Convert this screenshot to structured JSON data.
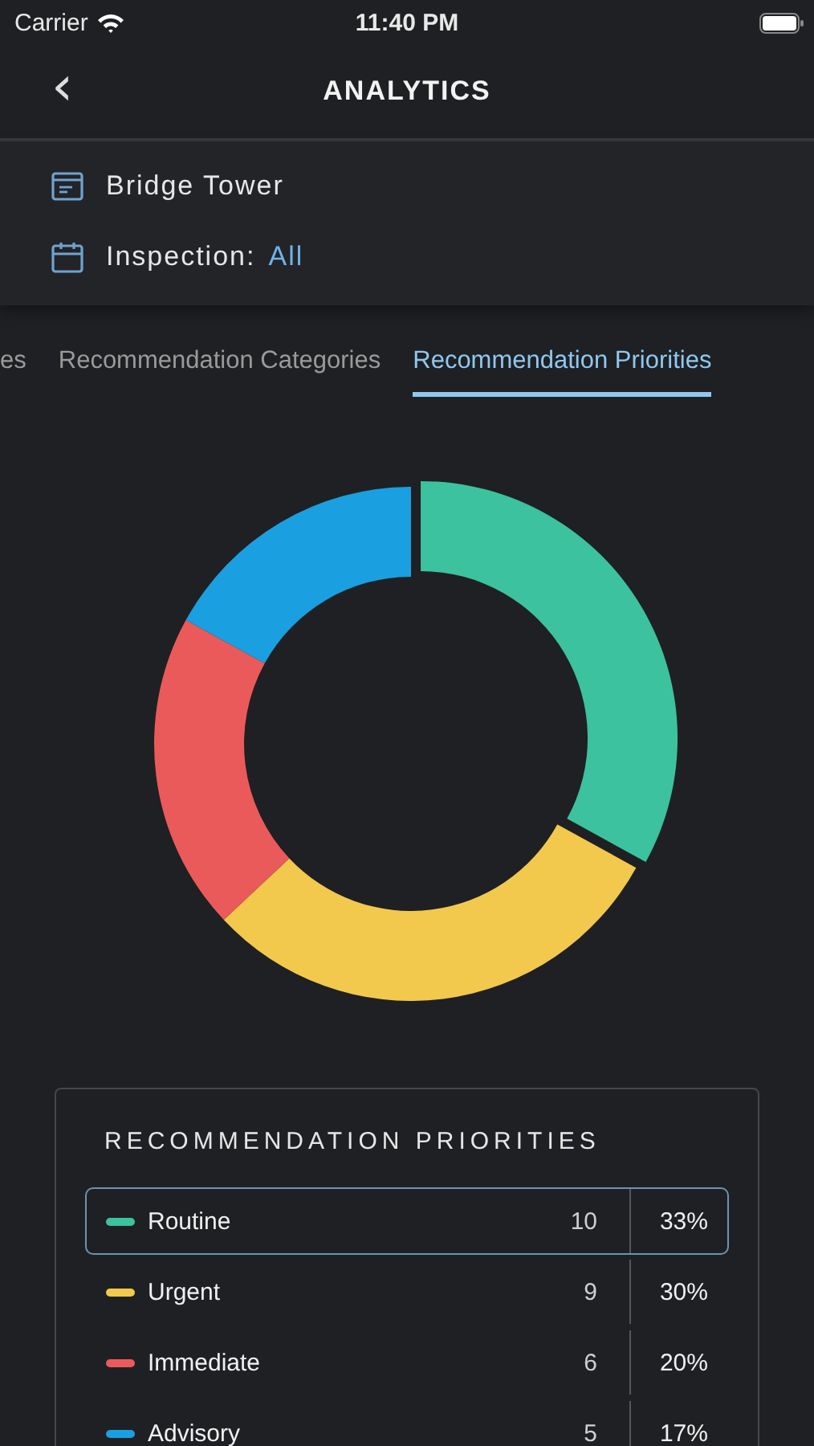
{
  "status_bar": {
    "carrier": "Carrier",
    "time": "11:40 PM"
  },
  "nav": {
    "back": "‹",
    "title": "ANALYTICS"
  },
  "info": {
    "site": "Bridge Tower",
    "inspection_label": "Inspection:",
    "inspection_value": "All"
  },
  "tabs": [
    {
      "label": "es",
      "selected": false
    },
    {
      "label": "Recommendation Categories",
      "selected": false
    },
    {
      "label": "Recommendation Priorities",
      "selected": true
    }
  ],
  "chart_data": {
    "type": "donut",
    "categories": [
      "Routine",
      "Urgent",
      "Immediate",
      "Advisory"
    ],
    "values": [
      33,
      30,
      20,
      17
    ]
  },
  "legend": {
    "title": "RECOMMENDATION PRIORITIES",
    "rows": [
      {
        "count": "10",
        "percent": "33%",
        "color": "#3cc29e",
        "selected": true
      },
      {
        "count": "9",
        "percent": "30%",
        "color": "#f2c94c",
        "selected": false
      },
      {
        "count": "6",
        "percent": "20%",
        "color": "#eb5a5a",
        "selected": false
      },
      {
        "count": "5",
        "percent": "17%",
        "color": "#1a9fe0",
        "selected": false
      }
    ]
  }
}
